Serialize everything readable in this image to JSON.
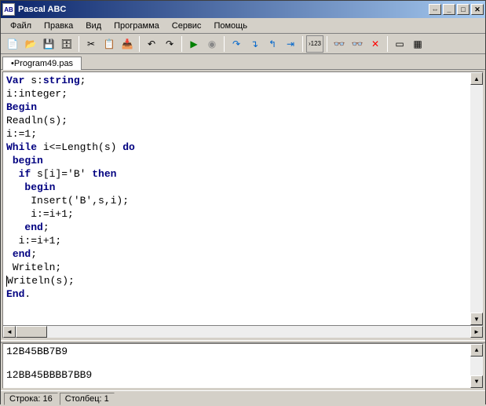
{
  "window": {
    "title": "Pascal ABC",
    "icon_label": "AB"
  },
  "menu": {
    "items": [
      "Файл",
      "Правка",
      "Вид",
      "Программа",
      "Сервис",
      "Помощь"
    ]
  },
  "toolbar_icons": {
    "new": "new-file-icon",
    "open": "open-folder-icon",
    "save": "save-icon",
    "saveall": "save-all-icon",
    "cut": "cut-icon",
    "copy": "copy-icon",
    "paste": "paste-icon",
    "undo": "undo-icon",
    "redo": "redo-icon",
    "run": "run-icon",
    "stop": "stop-icon",
    "stepover": "step-over-icon",
    "stepinto": "step-into-icon",
    "stepout": "step-out-icon",
    "runto": "run-to-icon",
    "eval": "eval-icon",
    "watch": "watch-icon",
    "break": "breakpoint-icon",
    "close": "close-icon",
    "window": "window-icon",
    "robot": "robot-icon"
  },
  "tab": {
    "label": "•Program49.pas"
  },
  "code": {
    "l1a": "Var",
    "l1b": " s:",
    "l1c": "string",
    "l1d": ";",
    "l2": "i:integer;",
    "l3": "Begin",
    "l4": "Readln(s);",
    "l5": "i:=1;",
    "l6a": "While",
    "l6b": " i<=Length(s) ",
    "l6c": "do",
    "l7": "begin",
    "l8a": "if",
    "l8b": " s[i]='B' ",
    "l8c": "then",
    "l9": "begin",
    "l10": "Insert('B',s,i);",
    "l11": "i:=i+1;",
    "l12": "end",
    "l12s": ";",
    "l13": "i:=i+1;",
    "l14": "end",
    "l14s": ";",
    "l15": "Writeln;",
    "l16": "Writeln(s);",
    "l17": "End",
    "l17s": "."
  },
  "output": {
    "line1": "12B45BB7B9",
    "line2": "12BB45BBBB7BB9"
  },
  "status": {
    "line_label": "Строка: 16",
    "col_label": "Столбец: 1"
  }
}
